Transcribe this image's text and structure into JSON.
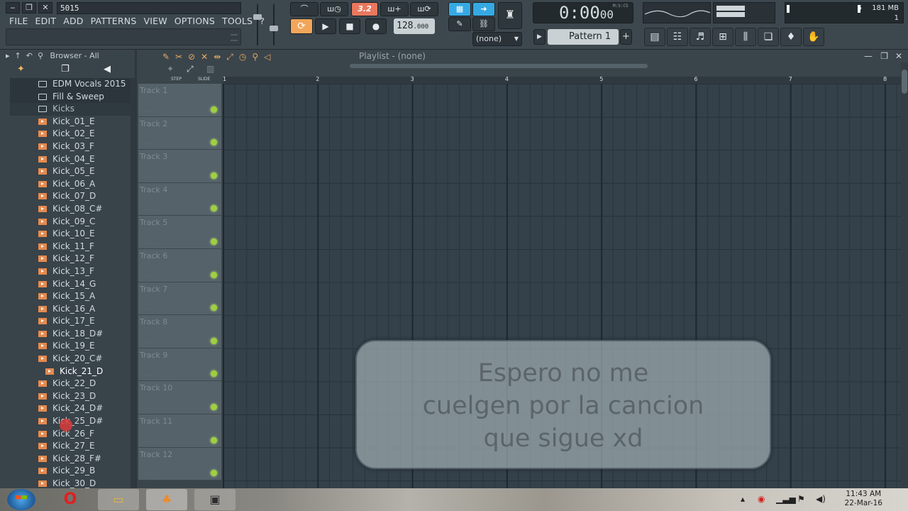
{
  "window": {
    "song_title": "5015",
    "minimize_glyph": "‒",
    "restore_glyph": "❐",
    "close_glyph": "✕"
  },
  "menu": [
    "FILE",
    "EDIT",
    "ADD",
    "PATTERNS",
    "VIEW",
    "OPTIONS",
    "TOOLS",
    "?"
  ],
  "transport": {
    "snap_label": "3.2",
    "tempo": "128",
    "tempo_decimals": ".000",
    "time": "0:00",
    "time_ms": "00",
    "time_format": "M:S:CS",
    "play_glyph": "▶",
    "stop_glyph": "■",
    "record_glyph": "●",
    "loop_glyph": "⟳"
  },
  "snap_dropdown": "(none)",
  "pattern": {
    "label": "Pattern 1",
    "play_glyph": "▶",
    "add_glyph": "+"
  },
  "cpu": {
    "value": "5",
    "memory": "181 MB",
    "polyphony": "1"
  },
  "browser": {
    "header": "Browser - All",
    "items": [
      {
        "label": "EDM Vocals 2015",
        "kind": "folder"
      },
      {
        "label": "Fill & Sweep",
        "kind": "folder"
      },
      {
        "label": "Kicks",
        "kind": "folder-open"
      },
      {
        "label": "Kick_01_E",
        "kind": "file"
      },
      {
        "label": "Kick_02_E",
        "kind": "file"
      },
      {
        "label": "Kick_03_F",
        "kind": "file"
      },
      {
        "label": "Kick_04_E",
        "kind": "file"
      },
      {
        "label": "Kick_05_E",
        "kind": "file"
      },
      {
        "label": "Kick_06_A",
        "kind": "file"
      },
      {
        "label": "Kick_07_D",
        "kind": "file"
      },
      {
        "label": "Kick_08_C#",
        "kind": "file"
      },
      {
        "label": "Kick_09_C",
        "kind": "file"
      },
      {
        "label": "Kick_10_E",
        "kind": "file"
      },
      {
        "label": "Kick_11_F",
        "kind": "file"
      },
      {
        "label": "Kick_12_F",
        "kind": "file"
      },
      {
        "label": "Kick_13_F",
        "kind": "file"
      },
      {
        "label": "Kick_14_G",
        "kind": "file"
      },
      {
        "label": "Kick_15_A",
        "kind": "file"
      },
      {
        "label": "Kick_16_A",
        "kind": "file"
      },
      {
        "label": "Kick_17_E",
        "kind": "file"
      },
      {
        "label": "Kick_18_D#",
        "kind": "file"
      },
      {
        "label": "Kick_19_E",
        "kind": "file"
      },
      {
        "label": "Kick_20_C#",
        "kind": "file"
      },
      {
        "label": "Kick_21_D",
        "kind": "file-selected"
      },
      {
        "label": "Kick_22_D",
        "kind": "file"
      },
      {
        "label": "Kick_23_D",
        "kind": "file"
      },
      {
        "label": "Kick_24_D#",
        "kind": "file"
      },
      {
        "label": "Kick_25_D#",
        "kind": "file"
      },
      {
        "label": "Kick_26_F",
        "kind": "file"
      },
      {
        "label": "Kick_27_E",
        "kind": "file"
      },
      {
        "label": "Kick_28_F#",
        "kind": "file"
      },
      {
        "label": "Kick_29_B",
        "kind": "file"
      },
      {
        "label": "Kick_30_D",
        "kind": "file"
      }
    ]
  },
  "playlist": {
    "title": "Playlist - (none)",
    "step_label": "STEP",
    "slide_label": "SLIDE",
    "bars": [
      "1",
      "2",
      "3",
      "4",
      "5",
      "6",
      "7",
      "8"
    ],
    "tracks": [
      "Track 1",
      "Track 2",
      "Track 3",
      "Track 4",
      "Track 5",
      "Track 6",
      "Track 7",
      "Track 8",
      "Track 9",
      "Track 10",
      "Track 11",
      "Track 12"
    ]
  },
  "caption": {
    "lines": [
      "Espero no me",
      "cuelgen por la cancion",
      "que sigue xd"
    ]
  },
  "taskbar": {
    "time": "11:43 AM",
    "date": "22-Mar-16"
  },
  "colors": {
    "accent_orange": "#f2a65a",
    "accent_blue": "#35a9e3",
    "accent_red": "#e8785e",
    "track_led": "#9ed03e"
  }
}
